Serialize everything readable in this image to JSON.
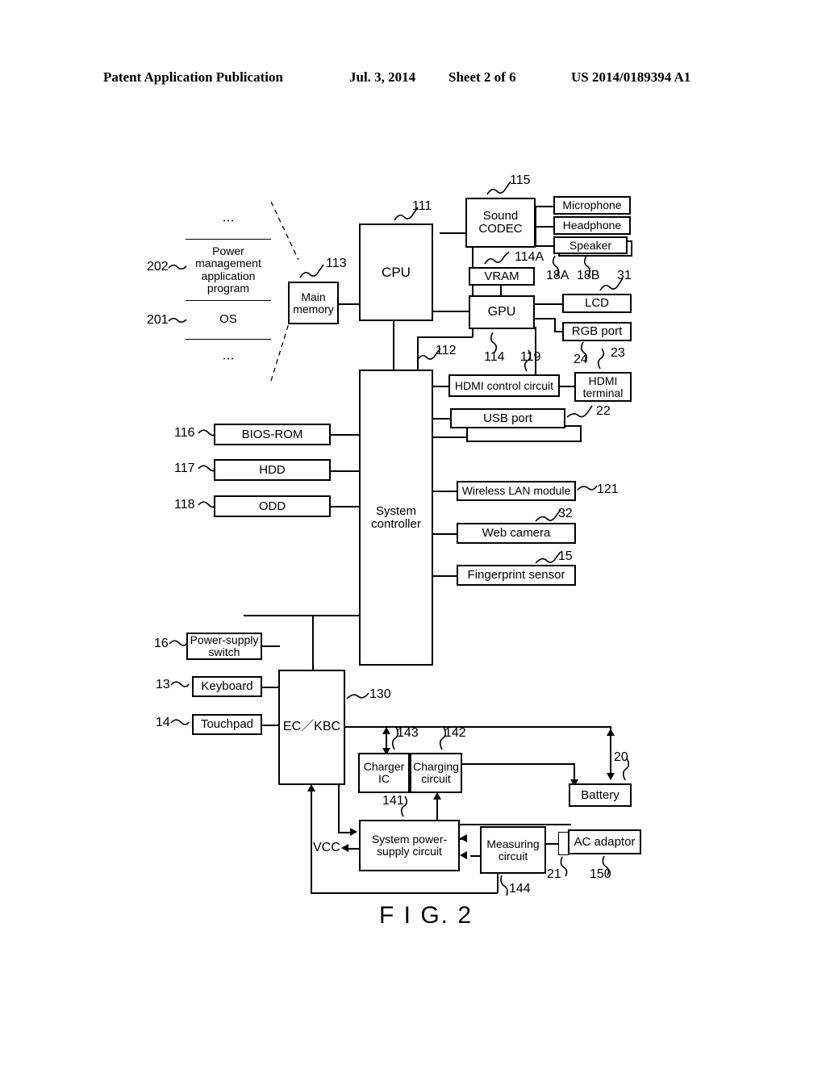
{
  "header": {
    "publication": "Patent Application Publication",
    "date": "Jul. 3, 2014",
    "sheet": "Sheet 2 of 6",
    "number": "US 2014/0189394 A1"
  },
  "figure": {
    "caption": "F I G. 2",
    "vcc_label": "VCC",
    "vertical_dots": "⋮"
  },
  "blocks": {
    "power_mgmt_app": "Power management application program",
    "os": "OS",
    "main_memory": "Main memory",
    "cpu": "CPU",
    "sound_codec": "Sound CODEC",
    "microphone": "Microphone",
    "headphone": "Headphone",
    "speaker": "Speaker",
    "vram": "VRAM",
    "gpu": "GPU",
    "lcd": "LCD",
    "rgb_port": "RGB port",
    "hdmi_control": "HDMI control circuit",
    "hdmi_terminal": "HDMI terminal",
    "usb_port": "USB port",
    "bios_rom": "BIOS-ROM",
    "hdd": "HDD",
    "odd": "ODD",
    "system_controller": "System controller",
    "wireless_lan": "Wireless LAN module",
    "web_camera": "Web camera",
    "fingerprint_sensor": "Fingerprint sensor",
    "power_supply_switch": "Power-supply switch",
    "keyboard": "Keyboard",
    "touchpad": "Touchpad",
    "ec_kbc": "EC／KBC",
    "charger_ic": "Charger IC",
    "charging_circuit": "Charging circuit",
    "battery": "Battery",
    "system_power_supply": "System power-supply circuit",
    "measuring_circuit": "Measuring circuit",
    "ac_adaptor": "AC adaptor"
  },
  "refs": {
    "r202": "202",
    "r201": "201",
    "r113": "113",
    "r111": "111",
    "r115": "115",
    "r114A": "114A",
    "r18A": "18A",
    "r18B": "18B",
    "r31": "31",
    "r112": "112",
    "r114": "114",
    "r119": "119",
    "r24": "24",
    "r23": "23",
    "r22": "22",
    "r116": "116",
    "r117": "117",
    "r118": "118",
    "r121": "121",
    "r32": "32",
    "r15": "15",
    "r16": "16",
    "r13": "13",
    "r14": "14",
    "r130": "130",
    "r143": "143",
    "r142": "142",
    "r141": "141",
    "r144": "144",
    "r20": "20",
    "r21": "21",
    "r150": "150"
  }
}
